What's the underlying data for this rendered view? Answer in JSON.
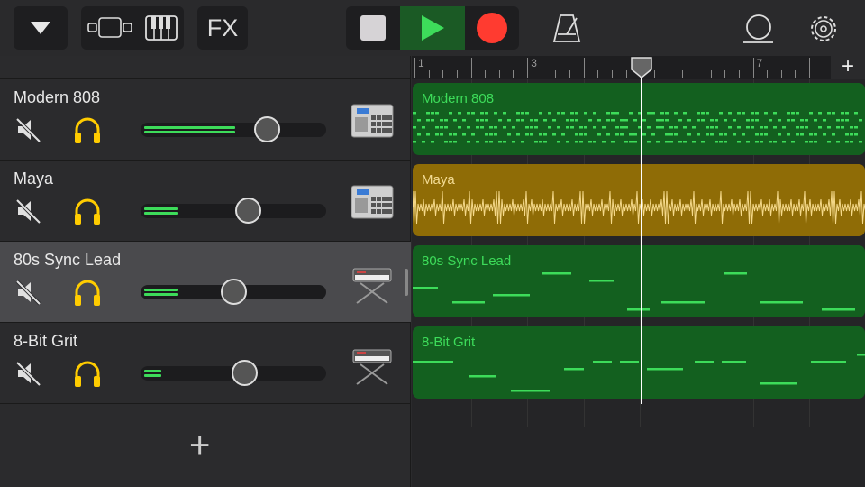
{
  "toolbar": {
    "fx_label": "FX"
  },
  "colors": {
    "accent_green": "#3ddc5a",
    "region_green": "#13601f",
    "region_gold": "#8f6c06",
    "record_red": "#ff3b30",
    "solo_yellow": "#ffcc00"
  },
  "ruler": {
    "bars": [
      "1",
      "3",
      "5",
      "7"
    ],
    "add_label": "+"
  },
  "tracks": [
    {
      "name": "Modern 808",
      "volume": 0.68,
      "level": 0.49,
      "instrument": "drum-machine-icon",
      "color": "green"
    },
    {
      "name": "Maya",
      "volume": 0.58,
      "level": 0.18,
      "instrument": "drum-machine-icon",
      "color": "gold"
    },
    {
      "name": "80s Sync Lead",
      "volume": 0.5,
      "level": 0.18,
      "instrument": "synth-keyboard-icon",
      "color": "green",
      "selected": true
    },
    {
      "name": "8-Bit Grit",
      "volume": 0.56,
      "level": 0.09,
      "instrument": "synth-keyboard-icon",
      "color": "green"
    }
  ],
  "add_track_label": "+"
}
